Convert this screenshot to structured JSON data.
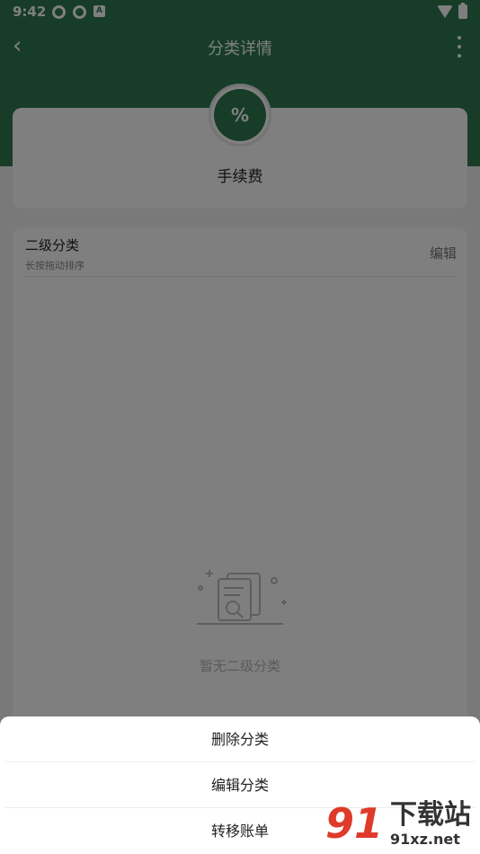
{
  "status_bar": {
    "time": "9:42",
    "icons": [
      "notification-icon",
      "notification-icon",
      "a-icon",
      "wifi-icon",
      "battery-icon"
    ]
  },
  "nav": {
    "title": "分类详情",
    "back_icon": "chevron-left-icon",
    "more_icon": "more-vertical-icon"
  },
  "category": {
    "name": "手续费",
    "icon": "percent-hand-icon",
    "icon_glyph": "%"
  },
  "subcategory": {
    "title": "二级分类",
    "hint": "长按拖动排序",
    "edit_label": "编辑",
    "empty_text": "暂无二级分类"
  },
  "sheet": {
    "items": [
      "删除分类",
      "编辑分类",
      "转移账单"
    ]
  },
  "watermark": {
    "logo": "91",
    "title": "下载站",
    "url": "91xz.net"
  },
  "colors": {
    "primary": "#2f7a52",
    "overlay": "rgba(0,0,0,0.5)",
    "watermark_red": "#e03a2a"
  }
}
